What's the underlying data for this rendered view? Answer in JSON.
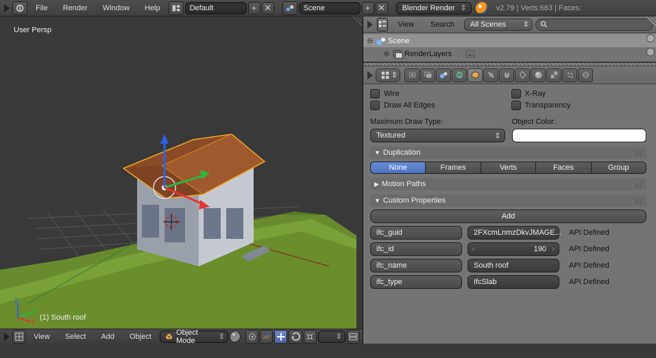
{
  "top": {
    "menus": [
      "File",
      "Render",
      "Window",
      "Help"
    ],
    "layout": "Default",
    "scene": "Scene",
    "engine": "Blender Render",
    "version": "v2.79",
    "stats": "Verts:663 | Faces:"
  },
  "viewport": {
    "persp_label": "User Persp",
    "object_label": "(1)  South roof",
    "header_menus": [
      "View",
      "Select",
      "Add",
      "Object"
    ],
    "mode": "Object Mode"
  },
  "outliner": {
    "menus": [
      "View",
      "Search"
    ],
    "scope": "All Scenes",
    "search_placeholder": "",
    "tree": {
      "scene": "Scene",
      "renderlayers": "RenderLayers"
    }
  },
  "properties": {
    "display": {
      "wire": "Wire",
      "xray": "X-Ray",
      "draw_all_edges": "Draw All Edges",
      "transparency": "Transparency",
      "max_draw_label": "Maximum Draw Type:",
      "max_draw_value": "Textured",
      "obj_color_label": "Object Color:"
    },
    "duplication": {
      "title": "Duplication",
      "opts": [
        "None",
        "Frames",
        "Verts",
        "Faces",
        "Group"
      ]
    },
    "motion_paths": {
      "title": "Motion Paths"
    },
    "custom": {
      "title": "Custom Properties",
      "add": "Add",
      "rows": [
        {
          "name": "ifc_guid",
          "value": "2FXcmLnmzDkvJMAGE...",
          "api": "API Defined",
          "type": "text"
        },
        {
          "name": "ifc_id",
          "value": "190",
          "api": "API Defined",
          "type": "number"
        },
        {
          "name": "ifc_name",
          "value": "South roof",
          "api": "API Defined",
          "type": "text"
        },
        {
          "name": "ifc_type",
          "value": "IfcSlab",
          "api": "API Defined",
          "type": "text"
        }
      ]
    }
  }
}
